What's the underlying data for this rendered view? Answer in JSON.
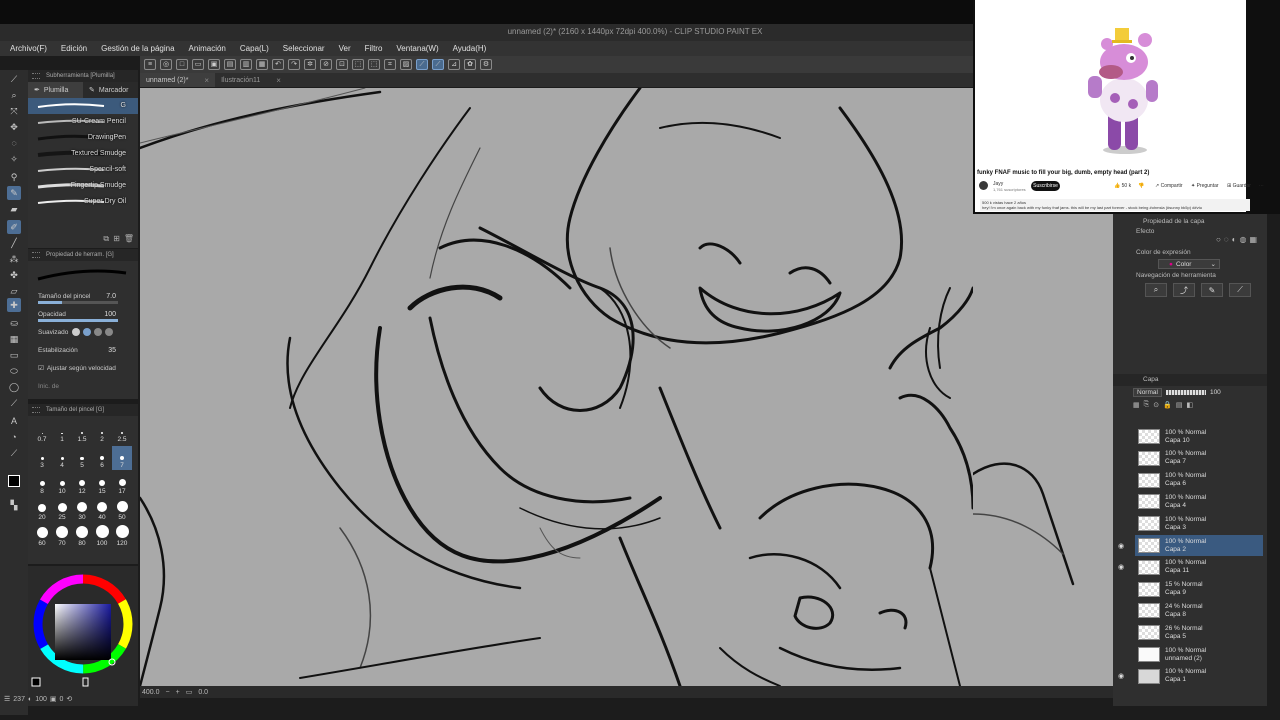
{
  "window": {
    "title": "unnamed (2)* (2160 x 1440px 72dpi 400.0%) - CLIP STUDIO PAINT EX"
  },
  "menu": [
    "Archivo(F)",
    "Edición",
    "Gestión de la página",
    "Animación",
    "Capa(L)",
    "Seleccionar",
    "Ver",
    "Filtro",
    "Ventana(W)",
    "Ayuda(H)"
  ],
  "tabs": [
    {
      "label": "unnamed (2)*",
      "active": true
    },
    {
      "label": "Ilustración11",
      "active": false
    }
  ],
  "subtool": {
    "header": "Subherramienta [Plumilla]",
    "tab_pen": "Plumilla",
    "tab_marker": "Marcador",
    "brushes": [
      "G",
      "SU-Cream Pencil",
      "DrawingPen",
      "Textured Smudge",
      "Spencil-soft",
      "Fingertip Smudge",
      "Super Dry Oil"
    ]
  },
  "tool_property": {
    "header": "Propiedad de herram. [G]",
    "size_label": "Tamaño del pincel",
    "size_value": "7.0",
    "opacity_label": "Opacidad",
    "opacity_value": "100",
    "smoothing_label": "Suavizado",
    "stabilization_label": "Estabilización",
    "stabilization_value": "35",
    "speed_label": "Ajustar según velocidad",
    "start_label": "Inic. de"
  },
  "brush_size": {
    "header": "Tamaño del pincel [G]",
    "sizes": [
      "0.7",
      "1",
      "1.5",
      "2",
      "2.5",
      "3",
      "4",
      "5",
      "6",
      "7",
      "8",
      "10",
      "12",
      "15",
      "17",
      "20",
      "25",
      "30",
      "40",
      "50",
      "60",
      "70",
      "80",
      "100",
      "120"
    ],
    "selected": "7"
  },
  "left_status": {
    "a": "237",
    "b": "100",
    "c": "0"
  },
  "status": {
    "zoom": "400.0",
    "rot": "0.0"
  },
  "layer_property": {
    "header": "Propiedad de la capa",
    "effect_label": "Efecto",
    "expression_label": "Color de expresión",
    "expression_value": "Color",
    "nav_label": "Navegación de herramienta"
  },
  "layers_panel": {
    "header": "Capa",
    "blend": "Normal",
    "opacity": "100",
    "layers": [
      {
        "opacity": "100 % Normal",
        "name": "Capa 10",
        "thumb": "check",
        "visible": false
      },
      {
        "opacity": "100 % Normal",
        "name": "Capa 7",
        "thumb": "check",
        "visible": false
      },
      {
        "opacity": "100 % Normal",
        "name": "Capa 6",
        "thumb": "check",
        "visible": false
      },
      {
        "opacity": "100 % Normal",
        "name": "Capa 4",
        "thumb": "check",
        "visible": false
      },
      {
        "opacity": "100 % Normal",
        "name": "Capa 3",
        "thumb": "check",
        "visible": false
      },
      {
        "opacity": "100 % Normal",
        "name": "Capa 2",
        "thumb": "check",
        "visible": true,
        "selected": true
      },
      {
        "opacity": "100 % Normal",
        "name": "Capa 11",
        "thumb": "check",
        "visible": true
      },
      {
        "opacity": "15 % Normal",
        "name": "Capa 9",
        "thumb": "check",
        "visible": false
      },
      {
        "opacity": "24 % Normal",
        "name": "Capa 8",
        "thumb": "check",
        "visible": false
      },
      {
        "opacity": "26 % Normal",
        "name": "Capa 5",
        "thumb": "check",
        "visible": false
      },
      {
        "opacity": "100 % Normal",
        "name": "unnamed (2)",
        "thumb": "solid",
        "visible": false
      },
      {
        "opacity": "100 % Normal",
        "name": "Capa 1",
        "thumb": "grey",
        "visible": true
      }
    ]
  },
  "youtube": {
    "title": "funky FNAF music to fill your big, dumb, empty head (part 2)",
    "channel": "Jayy",
    "subscribers": "1,761 suscriptores",
    "subscribe": "Suscribirse",
    "likes": "50 k",
    "share": "Compartir",
    "thanks": "Preguntar",
    "save": "Guardar",
    "views": "500 k vistas  hace 2 años",
    "desc": "hey! i'm once again back with my funky fnaf jams. this will be my last part forever - stock being #ohmsla (#sunny bk5p) ##vtu"
  },
  "colors": {
    "canvas": "#a9a9a9",
    "panel": "#2f2f2f",
    "accent": "#4d6e95",
    "selected_layer": "#3a5a80"
  }
}
